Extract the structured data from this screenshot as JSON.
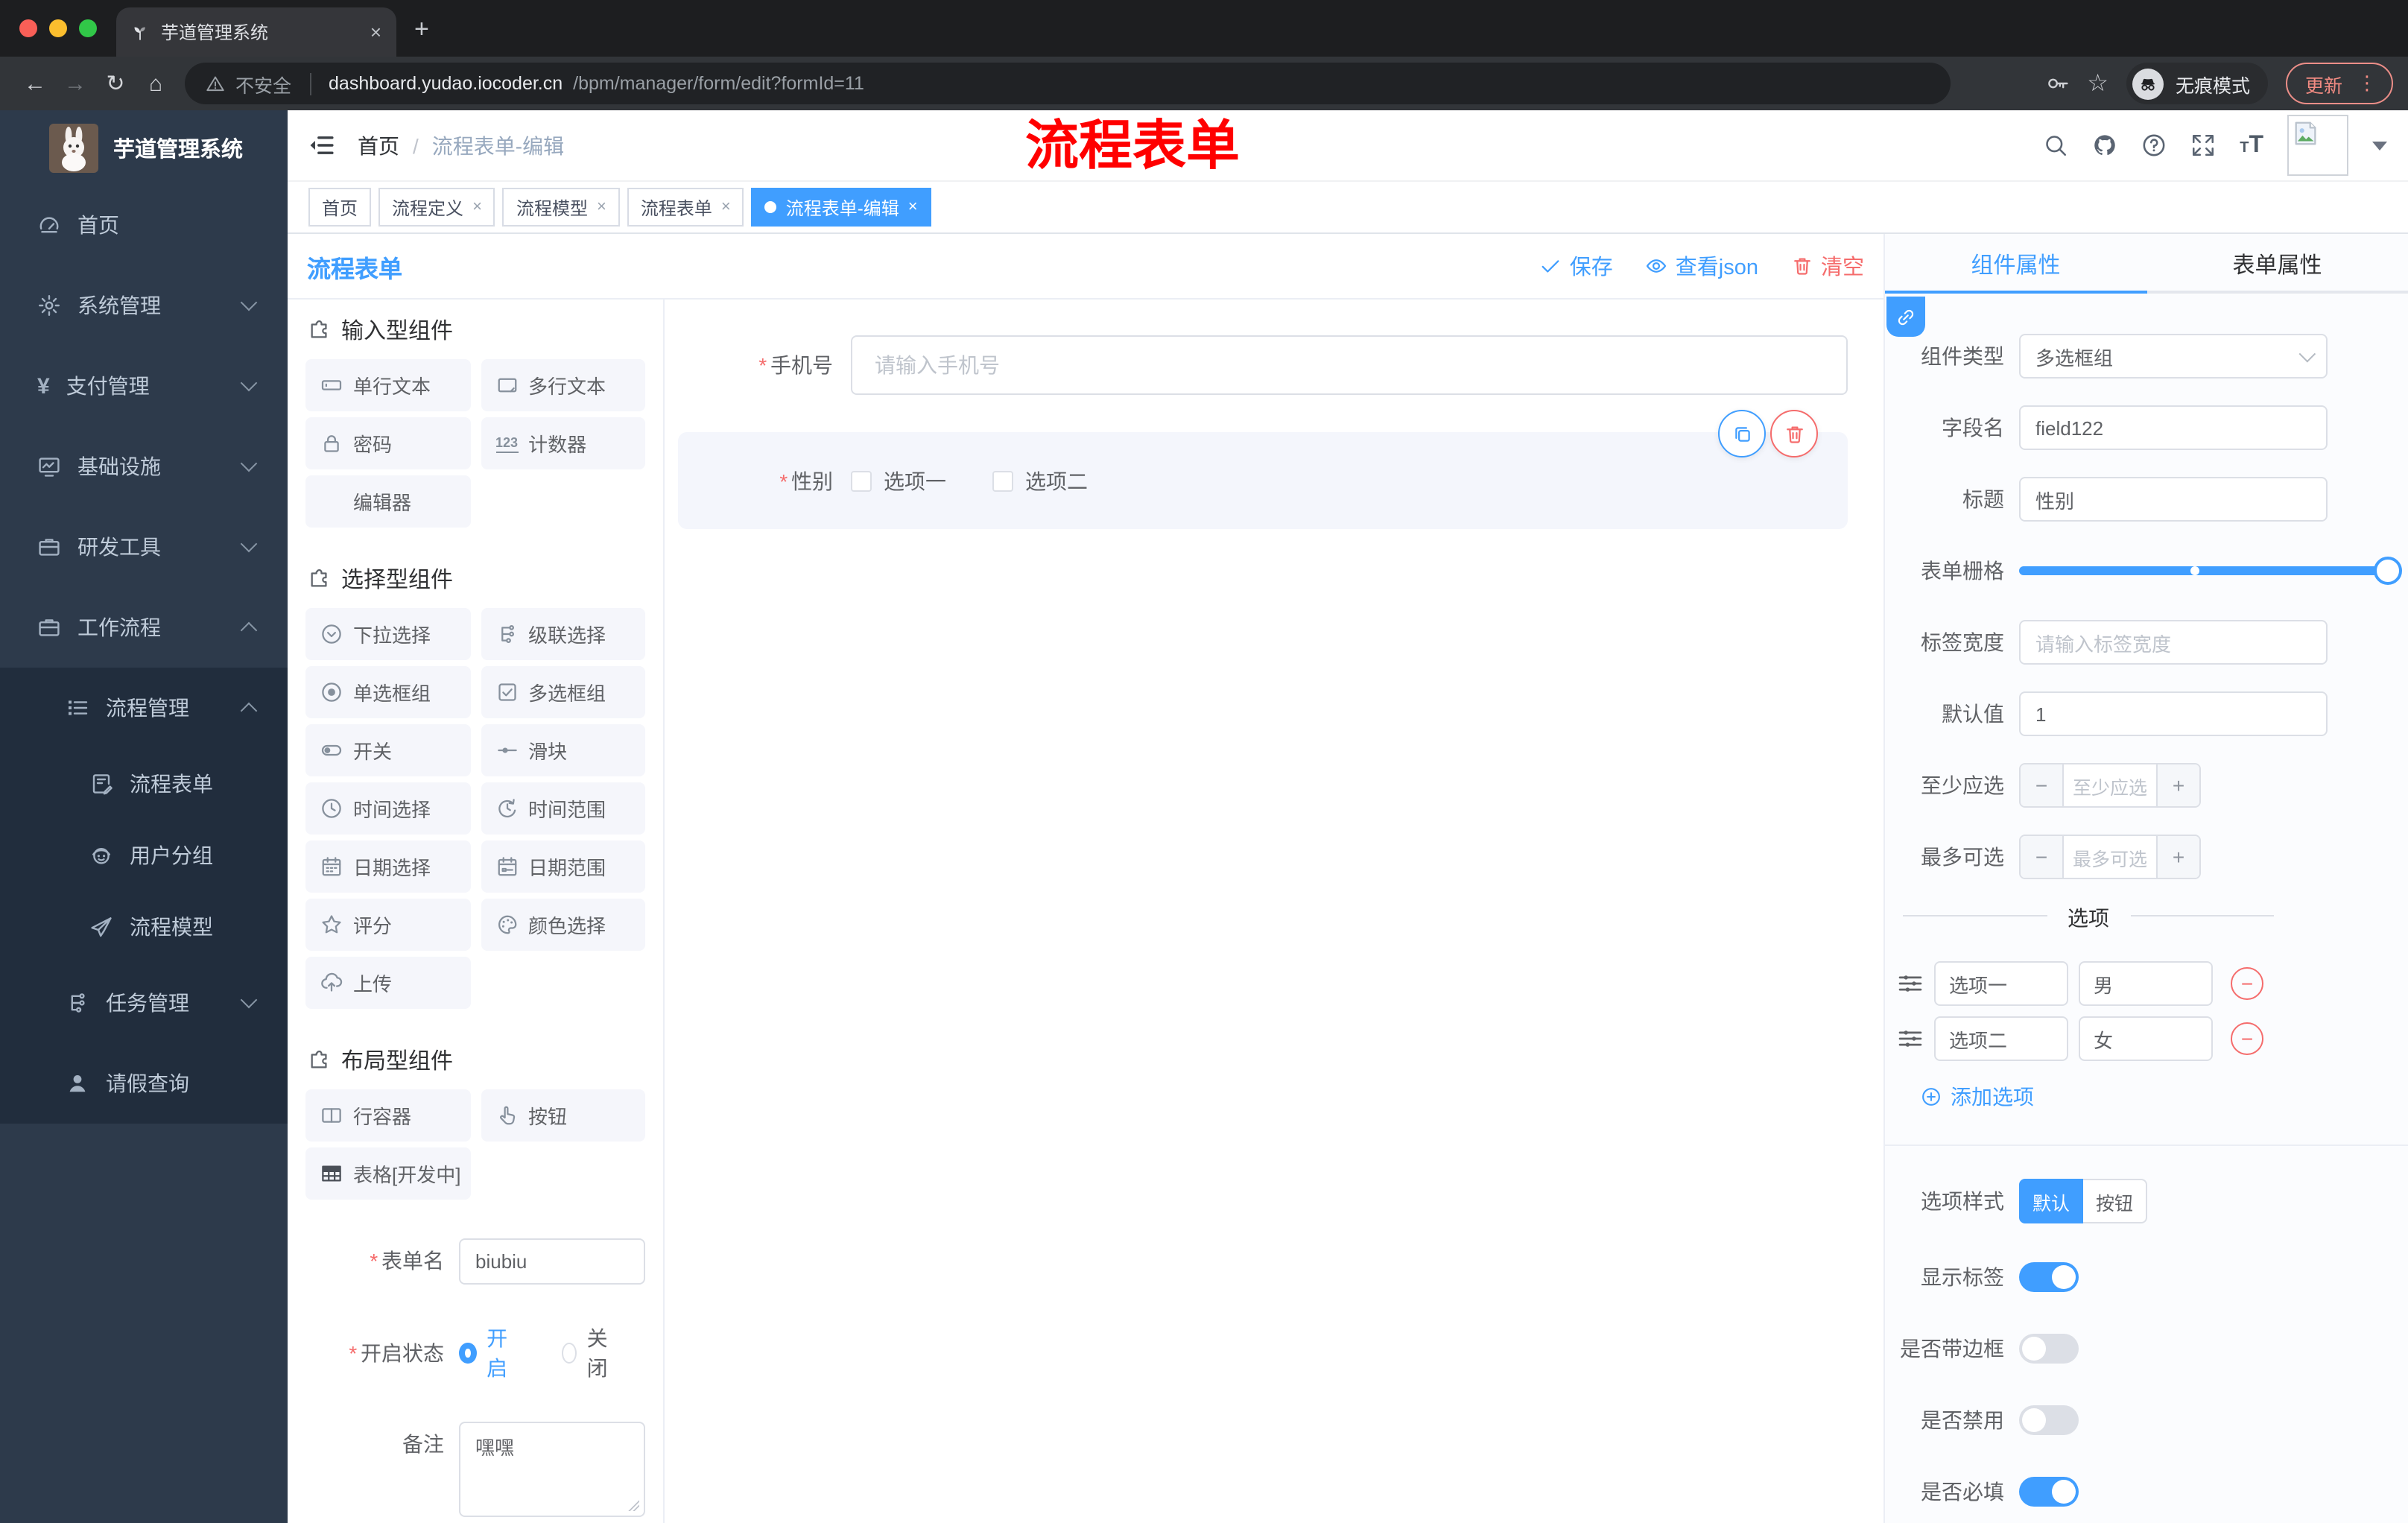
{
  "colors": {
    "accent": "#409eff",
    "danger": "#f56c6c",
    "annotation_red": "#ff0000"
  },
  "browser": {
    "tab_title": "芋道管理系统",
    "not_secure": "不安全",
    "url_domain": "dashboard.yudao.iocoder.cn",
    "url_path": "/bpm/manager/form/edit?formId=11",
    "incognito_label": "无痕模式",
    "update_label": "更新"
  },
  "sidebar": {
    "logo_title": "芋道管理系统",
    "items": [
      {
        "id": "home",
        "label": "首页",
        "icon": "dashboard",
        "level": 1
      },
      {
        "id": "system",
        "label": "系统管理",
        "icon": "gear",
        "level": 1,
        "chevron": "down"
      },
      {
        "id": "payment",
        "label": "支付管理",
        "icon": "yen",
        "level": 1,
        "chevron": "down"
      },
      {
        "id": "infra",
        "label": "基础设施",
        "icon": "monitor",
        "level": 1,
        "chevron": "down"
      },
      {
        "id": "devtools",
        "label": "研发工具",
        "icon": "briefcase",
        "level": 1,
        "chevron": "down"
      },
      {
        "id": "workflow",
        "label": "工作流程",
        "icon": "briefcase",
        "level": 1,
        "chevron": "up"
      },
      {
        "id": "process-mgmt",
        "label": "流程管理",
        "icon": "flow",
        "level": 2,
        "chevron": "up",
        "dark": true
      },
      {
        "id": "process-form",
        "label": "流程表单",
        "icon": "docedit",
        "level": 3,
        "dark": true
      },
      {
        "id": "user-group",
        "label": "用户分组",
        "icon": "robot",
        "level": 3,
        "dark": true
      },
      {
        "id": "process-model",
        "label": "流程模型",
        "icon": "plane",
        "level": 3,
        "dark": true
      },
      {
        "id": "task-mgmt",
        "label": "任务管理",
        "icon": "orgtree",
        "level": 2,
        "chevron": "down",
        "dark": true
      },
      {
        "id": "leave-query",
        "label": "请假查询",
        "icon": "person",
        "level": 2,
        "dark": true
      }
    ]
  },
  "header": {
    "breadcrumb": [
      "首页",
      "流程表单-编辑"
    ],
    "annotation": "流程表单"
  },
  "tags": [
    {
      "id": "home",
      "label": "首页"
    },
    {
      "id": "process-def",
      "label": "流程定义",
      "closable": true
    },
    {
      "id": "process-model",
      "label": "流程模型",
      "closable": true
    },
    {
      "id": "process-form",
      "label": "流程表单",
      "closable": true
    },
    {
      "id": "process-form-edit",
      "label": "流程表单-编辑",
      "closable": true,
      "active": true
    }
  ],
  "editor": {
    "title": "流程表单",
    "actions": {
      "save": "保存",
      "view_json": "查看json",
      "clear": "清空"
    },
    "palette": {
      "sections": [
        {
          "title": "输入型组件",
          "items": [
            {
              "id": "single-text",
              "label": "单行文本",
              "icon": "inputbox"
            },
            {
              "id": "multi-text",
              "label": "多行文本",
              "icon": "textarea"
            },
            {
              "id": "password",
              "label": "密码",
              "icon": "lock"
            },
            {
              "id": "counter",
              "label": "计数器",
              "icon": "counter"
            },
            {
              "id": "editor",
              "label": "编辑器",
              "icon": null
            }
          ]
        },
        {
          "title": "选择型组件",
          "items": [
            {
              "id": "select",
              "label": "下拉选择",
              "icon": "select"
            },
            {
              "id": "cascader",
              "label": "级联选择",
              "icon": "orgtree"
            },
            {
              "id": "radio-group",
              "label": "单选框组",
              "icon": "radio"
            },
            {
              "id": "checkbox-group",
              "label": "多选框组",
              "icon": "checkbox"
            },
            {
              "id": "switch",
              "label": "开关",
              "icon": "switch"
            },
            {
              "id": "slider",
              "label": "滑块",
              "icon": "slider"
            },
            {
              "id": "time-picker",
              "label": "时间选择",
              "icon": "clock"
            },
            {
              "id": "time-range",
              "label": "时间范围",
              "icon": "clockrange"
            },
            {
              "id": "date-picker",
              "label": "日期选择",
              "icon": "calendar"
            },
            {
              "id": "date-range",
              "label": "日期范围",
              "icon": "calendarrange"
            },
            {
              "id": "rate",
              "label": "评分",
              "icon": "star"
            },
            {
              "id": "color-picker",
              "label": "颜色选择",
              "icon": "palette"
            },
            {
              "id": "upload",
              "label": "上传",
              "icon": "upload"
            }
          ]
        },
        {
          "title": "布局型组件",
          "items": [
            {
              "id": "row-container",
              "label": "行容器",
              "icon": "rowcontainer"
            },
            {
              "id": "button",
              "label": "按钮",
              "icon": "hand"
            },
            {
              "id": "table",
              "label": "表格[开发中]",
              "icon": "table"
            }
          ]
        }
      ]
    },
    "meta": {
      "form_name_label": "表单名",
      "form_name_value": "biubiu",
      "status_label": "开启状态",
      "status_on": "开启",
      "status_off": "关闭",
      "remark_label": "备注",
      "remark_value": "嘿嘿"
    },
    "canvas": {
      "phone": {
        "label": "手机号",
        "placeholder": "请输入手机号"
      },
      "gender": {
        "label": "性别",
        "options": [
          "选项一",
          "选项二"
        ]
      }
    },
    "props": {
      "tabs": [
        "组件属性",
        "表单属性"
      ],
      "component_type": {
        "label": "组件类型",
        "value": "多选框组"
      },
      "field_name": {
        "label": "字段名",
        "value": "field122"
      },
      "title": {
        "label": "标题",
        "value": "性别"
      },
      "grid": {
        "label": "表单栅格"
      },
      "label_width": {
        "label": "标签宽度",
        "placeholder": "请输入标签宽度"
      },
      "default_value": {
        "label": "默认值",
        "value": "1"
      },
      "min_select": {
        "label": "至少应选",
        "placeholder": "至少应选"
      },
      "max_select": {
        "label": "最多可选",
        "placeholder": "最多可选"
      },
      "options_title": "选项",
      "options": [
        {
          "label": "选项一",
          "value": "男"
        },
        {
          "label": "选项二",
          "value": "女"
        }
      ],
      "add_option": "添加选项",
      "option_style": {
        "label": "选项样式",
        "options": [
          "默认",
          "按钮"
        ],
        "active": "默认"
      },
      "switches": [
        {
          "id": "show-label",
          "label": "显示标签",
          "on": true
        },
        {
          "id": "bordered",
          "label": "是否带边框",
          "on": false
        },
        {
          "id": "disabled",
          "label": "是否禁用",
          "on": false
        },
        {
          "id": "required",
          "label": "是否必填",
          "on": true
        }
      ]
    }
  }
}
